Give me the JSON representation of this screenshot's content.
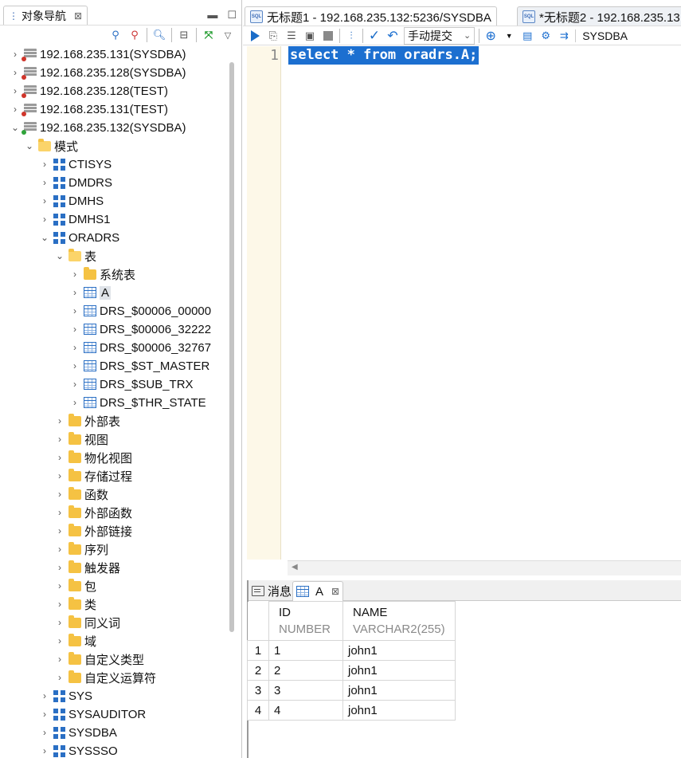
{
  "navigator": {
    "tab_label": "对象导航",
    "close_glyph": "⊠",
    "tree": [
      {
        "label": "192.168.235.131(SYSDBA)",
        "level": 0,
        "icon": "db-icon",
        "expanded": false,
        "status": "red"
      },
      {
        "label": "192.168.235.128(SYSDBA)",
        "level": 0,
        "icon": "db-icon",
        "expanded": false,
        "status": "red"
      },
      {
        "label": "192.168.235.128(TEST)",
        "level": 0,
        "icon": "db-icon",
        "expanded": false,
        "status": "red"
      },
      {
        "label": "192.168.235.131(TEST)",
        "level": 0,
        "icon": "db-icon",
        "expanded": false,
        "status": "red"
      },
      {
        "label": "192.168.235.132(SYSDBA)",
        "level": 0,
        "icon": "db-icon",
        "expanded": true,
        "status": "green"
      },
      {
        "label": "模式",
        "level": 1,
        "icon": "folder-open-icon",
        "expanded": true
      },
      {
        "label": "CTISYS",
        "level": 2,
        "icon": "schema-icon",
        "expanded": false
      },
      {
        "label": "DMDRS",
        "level": 2,
        "icon": "schema-icon",
        "expanded": false
      },
      {
        "label": "DMHS",
        "level": 2,
        "icon": "schema-icon",
        "expanded": false
      },
      {
        "label": "DMHS1",
        "level": 2,
        "icon": "schema-icon",
        "expanded": false
      },
      {
        "label": "ORADRS",
        "level": 2,
        "icon": "schema-icon",
        "expanded": true
      },
      {
        "label": "表",
        "level": 3,
        "icon": "folder-open-icon",
        "expanded": true
      },
      {
        "label": "系统表",
        "level": 4,
        "icon": "folder-icon",
        "expanded": false
      },
      {
        "label": "A",
        "level": 4,
        "icon": "table-icon",
        "expanded": false,
        "selected": true
      },
      {
        "label": "DRS_$00006_00000",
        "level": 4,
        "icon": "table-icon",
        "expanded": false
      },
      {
        "label": "DRS_$00006_32222",
        "level": 4,
        "icon": "table-icon",
        "expanded": false
      },
      {
        "label": "DRS_$00006_32767",
        "level": 4,
        "icon": "table-icon",
        "expanded": false
      },
      {
        "label": "DRS_$ST_MASTER",
        "level": 4,
        "icon": "table-icon",
        "expanded": false
      },
      {
        "label": "DRS_$SUB_TRX",
        "level": 4,
        "icon": "table-icon",
        "expanded": false
      },
      {
        "label": "DRS_$THR_STATE",
        "level": 4,
        "icon": "table-icon",
        "expanded": false
      },
      {
        "label": "外部表",
        "level": 3,
        "icon": "folder-icon",
        "expanded": false
      },
      {
        "label": "视图",
        "level": 3,
        "icon": "folder-icon",
        "expanded": false
      },
      {
        "label": "物化视图",
        "level": 3,
        "icon": "folder-icon",
        "expanded": false
      },
      {
        "label": "存储过程",
        "level": 3,
        "icon": "folder-icon",
        "expanded": false
      },
      {
        "label": "函数",
        "level": 3,
        "icon": "folder-icon",
        "expanded": false
      },
      {
        "label": "外部函数",
        "level": 3,
        "icon": "folder-icon",
        "expanded": false
      },
      {
        "label": "外部链接",
        "level": 3,
        "icon": "folder-icon",
        "expanded": false
      },
      {
        "label": "序列",
        "level": 3,
        "icon": "folder-icon",
        "expanded": false
      },
      {
        "label": "触发器",
        "level": 3,
        "icon": "folder-icon",
        "expanded": false
      },
      {
        "label": "包",
        "level": 3,
        "icon": "folder-icon",
        "expanded": false
      },
      {
        "label": "类",
        "level": 3,
        "icon": "folder-icon",
        "expanded": false
      },
      {
        "label": "同义词",
        "level": 3,
        "icon": "folder-icon",
        "expanded": false
      },
      {
        "label": "域",
        "level": 3,
        "icon": "folder-icon",
        "expanded": false
      },
      {
        "label": "自定义类型",
        "level": 3,
        "icon": "folder-icon",
        "expanded": false
      },
      {
        "label": "自定义运算符",
        "level": 3,
        "icon": "folder-icon",
        "expanded": false
      },
      {
        "label": "SYS",
        "level": 2,
        "icon": "schema-icon",
        "expanded": false
      },
      {
        "label": "SYSAUDITOR",
        "level": 2,
        "icon": "schema-icon",
        "expanded": false
      },
      {
        "label": "SYSDBA",
        "level": 2,
        "icon": "schema-icon",
        "expanded": false
      },
      {
        "label": "SYSSSO",
        "level": 2,
        "icon": "schema-icon",
        "expanded": false
      }
    ]
  },
  "editor": {
    "tabs": [
      {
        "label": "无标题1 - 192.168.235.132:5236/SYSDBA",
        "active": true
      },
      {
        "label": "*无标题2 - 192.168.235.13",
        "active": false
      }
    ],
    "commit_mode": "手动提交",
    "current_schema": "SYSDBA",
    "line_number": "1",
    "sql": "select * from oradrs.A;"
  },
  "results": {
    "tabs": [
      {
        "label": "消息"
      },
      {
        "label": "A"
      }
    ],
    "columns": [
      {
        "name": "ID",
        "type": "NUMBER"
      },
      {
        "name": "NAME",
        "type": "VARCHAR2(255)"
      }
    ],
    "rows": [
      {
        "rn": "1",
        "id": "1",
        "name": "john1"
      },
      {
        "rn": "2",
        "id": "2",
        "name": "john1"
      },
      {
        "rn": "3",
        "id": "3",
        "name": "john1"
      },
      {
        "rn": "4",
        "id": "4",
        "name": "john1"
      }
    ]
  },
  "colors": {
    "accent": "#1c6fd0",
    "status_red": "#d0352b",
    "status_green": "#2fa33a"
  }
}
